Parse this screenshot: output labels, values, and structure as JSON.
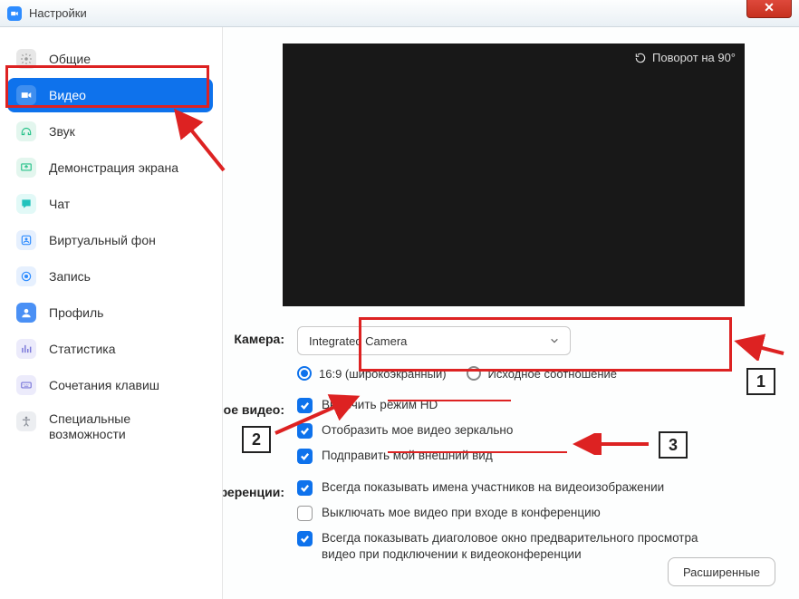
{
  "titlebar": {
    "title": "Настройки"
  },
  "close_btn": "✕",
  "sidebar": {
    "items": [
      {
        "label": "Общие",
        "icon": "gear",
        "icon_bg": "#e7e7e7",
        "icon_fg": "#9a9a9a"
      },
      {
        "label": "Видео",
        "icon": "video",
        "icon_bg": "#ffffff",
        "icon_fg": "#0E72EC",
        "active": true
      },
      {
        "label": "Звук",
        "icon": "audio",
        "icon_bg": "#e3f6ee",
        "icon_fg": "#28c28a"
      },
      {
        "label": "Демонстрация экрана",
        "icon": "share",
        "icon_bg": "#e3f6ee",
        "icon_fg": "#28c28a"
      },
      {
        "label": "Чат",
        "icon": "chat",
        "icon_bg": "#e2f9f7",
        "icon_fg": "#22c3bd"
      },
      {
        "label": "Виртуальный фон",
        "icon": "bg",
        "icon_bg": "#e6f0fe",
        "icon_fg": "#2D8CFF"
      },
      {
        "label": "Запись",
        "icon": "rec",
        "icon_bg": "#e6f0fe",
        "icon_fg": "#2D8CFF"
      },
      {
        "label": "Профиль",
        "icon": "profile",
        "icon_bg": "#4a90f5",
        "icon_fg": "#ffffff"
      },
      {
        "label": "Статистика",
        "icon": "stats",
        "icon_bg": "#ecebfb",
        "icon_fg": "#7a77d9"
      },
      {
        "label": "Сочетания клавиш",
        "icon": "keys",
        "icon_bg": "#ecebfb",
        "icon_fg": "#7a77d9"
      },
      {
        "label": "Специальные возможности",
        "icon": "access",
        "icon_bg": "#eceef1",
        "icon_fg": "#8a8f98",
        "multiline": true
      }
    ]
  },
  "preview": {
    "rotate_label": "Поворот на 90°"
  },
  "camera": {
    "label": "Камера:",
    "selected": "Integrated Camera",
    "aspect_16_9": "16:9 (широкоэкранный)",
    "aspect_orig": "Исходное соотношение"
  },
  "my_video": {
    "label": "Мое видео:",
    "hd": "Включить режим HD",
    "mirror": "Отобразить мое видео зеркально",
    "touchup": "Подправить мой внешний вид"
  },
  "meetings": {
    "label": "Конференции:",
    "show_names": "Всегда показывать имена участников на видеоизображении",
    "mute_on_join": "Выключать мое видео при входе в конференцию",
    "preview_dialog": "Всегда показывать диаголовое окно предварительного просмотра видео при подключении к видеоконференции"
  },
  "advanced_btn": "Расширенные",
  "annotations": {
    "n1": "1",
    "n2": "2",
    "n3": "3"
  }
}
